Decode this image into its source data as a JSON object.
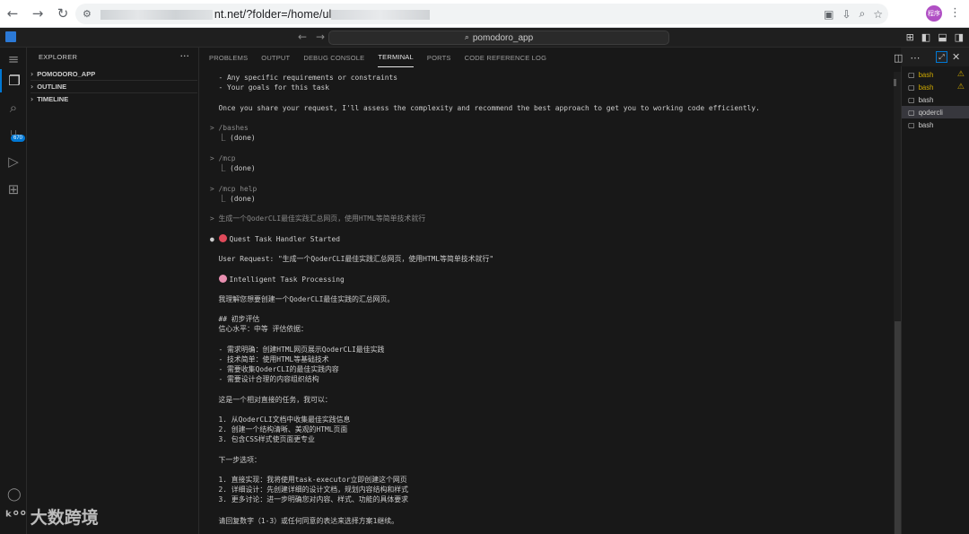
{
  "browser": {
    "url_visible_start": "nt.net/?folder=/home/ul",
    "back": "←",
    "forward": "→",
    "reload": "↻",
    "profile_initials": "程序",
    "menu": "⋮"
  },
  "titlebar": {
    "command_center": "pomodoro_app"
  },
  "activity": {
    "badge": "670"
  },
  "explorer": {
    "header": "EXPLORER",
    "more": "···",
    "sections": [
      "POMODORO_APP",
      "OUTLINE",
      "TIMELINE"
    ]
  },
  "panel": {
    "tabs": [
      "PROBLEMS",
      "OUTPUT",
      "DEBUG CONSOLE",
      "TERMINAL",
      "PORTS",
      "CODE REFERENCE LOG"
    ],
    "active_tab": "TERMINAL"
  },
  "terminal_lines": [
    "  - Any specific requirements or constraints",
    "  - Your goals for this task",
    "",
    "  Once you share your request, I'll assess the complexity and recommend the best approach to get you to working code efficiently.",
    "",
    "> /bashes",
    "  ⎿ (done)",
    "",
    "> /mcp",
    "  ⎿ (done)",
    "",
    "> /mcp help",
    "  ⎿ (done)",
    "",
    "> 生成一个QoderCLI最佳实践汇总网页，使用HTML等简单技术就行",
    "",
    "● Quest Task Handler Started",
    "",
    "  User Request: \"生成一个QoderCLI最佳实践汇总网页，使用HTML等简单技术就行\"",
    "",
    "  Intelligent Task Processing",
    "",
    "  我理解您想要创建一个QoderCLI最佳实践的汇总网页。",
    "",
    "  ## 初步评估",
    "  信心水平：中等 评估依据：",
    "",
    "  - 需求明确：创建HTML网页展示QoderCLI最佳实践",
    "  - 技术简单：使用HTML等基础技术",
    "  - 需要收集QoderCLI的最佳实践内容",
    "  - 需要设计合理的内容组织结构",
    "",
    "  这是一个相对直接的任务，我可以：",
    "",
    "  1. 从QoderCLI文档中收集最佳实践信息",
    "  2. 创建一个结构清晰、美观的HTML页面",
    "  3. 包含CSS样式使页面更专业",
    "",
    "  下一步选项：",
    "",
    "  1. 直接实现：我将使用task-executor立即创建这个网页",
    "  2. 详细设计：先创建详细的设计文档，规划内容结构和样式",
    "  3. 更多讨论：进一步明确您对内容、样式、功能的具体要求",
    "",
    "  请回复数字（1-3）或任何同意的表达来选择方案1继续。"
  ],
  "terminal_list": [
    {
      "label": "bash",
      "warning": true
    },
    {
      "label": "bash",
      "warning": true
    },
    {
      "label": "bash",
      "warning": false
    },
    {
      "label": "qodercli",
      "warning": false,
      "selected": true
    },
    {
      "label": "bash",
      "warning": false
    }
  ],
  "watermark": "大数跨境"
}
